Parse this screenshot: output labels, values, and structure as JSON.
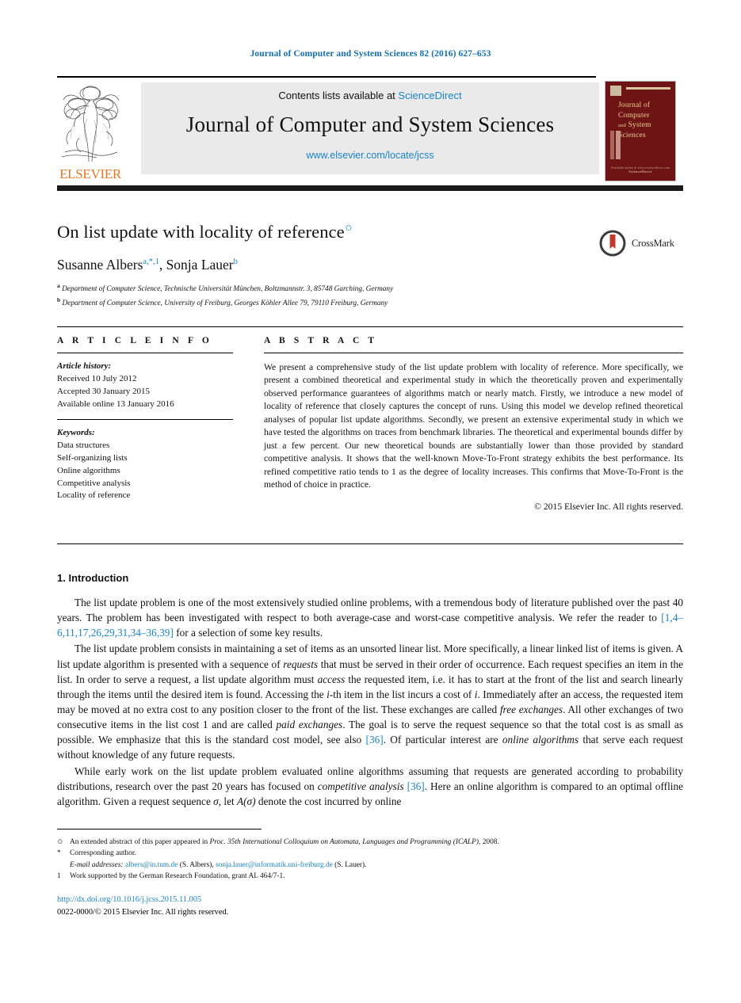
{
  "running_head": "Journal of Computer and System Sciences 82 (2016) 627–653",
  "masthead": {
    "contents_prefix": "Contents lists available at ",
    "sciencedirect": "ScienceDirect",
    "journal_name": "Journal of Computer and System Sciences",
    "journal_url": "www.elsevier.com/locate/jcss",
    "publisher_wordmark": "ELSEVIER",
    "cover": {
      "line1": "Journal of",
      "line2": "Computer",
      "line3_small": "and",
      "line3": "System",
      "line4": "Sciences",
      "foot1": "Available online at www.sciencedirect.com",
      "foot2": "ScienceDirect"
    }
  },
  "article": {
    "title": "On list update with locality of reference",
    "title_footnote_mark": "✩",
    "authors": "Susanne Albers, Sonja Lauer",
    "author1": "Susanne Albers",
    "author1_marks": "a,*,1",
    "author2": "Sonja Lauer",
    "author2_marks": "b",
    "affiliations": [
      {
        "mark": "a",
        "text": "Department of Computer Science, Technische Universität München, Boltzmannstr. 3, 85748 Garching, Germany"
      },
      {
        "mark": "b",
        "text": "Department of Computer Science, University of Freiburg, Georges Köhler Allee 79, 79110 Freiburg, Germany"
      }
    ],
    "crossmark_label": "CrossMark"
  },
  "info": {
    "heading": "A R T I C L E    I N F O",
    "history_label": "Article history:",
    "history": [
      "Received 10 July 2012",
      "Accepted 30 January 2015",
      "Available online 13 January 2016"
    ],
    "keywords_label": "Keywords:",
    "keywords": [
      "Data structures",
      "Self-organizing lists",
      "Online algorithms",
      "Competitive analysis",
      "Locality of reference"
    ]
  },
  "abstract": {
    "heading": "A B S T R A C T",
    "text": "We present a comprehensive study of the list update problem with locality of reference. More specifically, we present a combined theoretical and experimental study in which the theoretically proven and experimentally observed performance guarantees of algorithms match or nearly match. Firstly, we introduce a new model of locality of reference that closely captures the concept of runs. Using this model we develop refined theoretical analyses of popular list update algorithms. Secondly, we present an extensive experimental study in which we have tested the algorithms on traces from benchmark libraries. The theoretical and experimental bounds differ by just a few percent. Our new theoretical bounds are substantially lower than those provided by standard competitive analysis. It shows that the well-known Move-To-Front strategy exhibits the best performance. Its refined competitive ratio tends to 1 as the degree of locality increases. This confirms that Move-To-Front is the method of choice in practice.",
    "copyright": "© 2015 Elsevier Inc. All rights reserved."
  },
  "body": {
    "section_number_title": "1. Introduction",
    "paragraph1_part1": "The list update problem is one of the most extensively studied online problems, with a tremendous body of literature published over the past 40 years. The problem has been investigated with respect to both average-case and worst-case competitive analysis. We refer the reader to ",
    "paragraph1_citation": "[1,4–6,11,17,26,29,31,34–36,39]",
    "paragraph1_part2": " for a selection of some key results.",
    "paragraph2_part1": "The list update problem consists in maintaining a set of items as an unsorted linear list. More specifically, a linear linked list of items is given. A list update algorithm is presented with a sequence of ",
    "paragraph2_it1": "requests",
    "paragraph2_part2": " that must be served in their order of occurrence. Each request specifies an item in the list. In order to serve a request, a list update algorithm must ",
    "paragraph2_it2": "access",
    "paragraph2_part3": " the requested item, i.e. it has to start at the front of the list and search linearly through the items until the desired item is found. Accessing the ",
    "paragraph2_it3": "i",
    "paragraph2_part4": "-th item in the list incurs a cost of ",
    "paragraph2_it4": "i",
    "paragraph2_part5": ". Immediately after an access, the requested item may be moved at no extra cost to any position closer to the front of the list. These exchanges are called ",
    "paragraph2_it5": "free exchanges",
    "paragraph2_part6": ". All other exchanges of two consecutive items in the list cost 1 and are called ",
    "paragraph2_it6": "paid exchanges",
    "paragraph2_part7": ". The goal is to serve the request sequence so that the total cost is as small as possible. We emphasize that this is the standard cost model, see also ",
    "paragraph2_citation": "[36]",
    "paragraph2_part8": ". Of particular interest are ",
    "paragraph2_it7": "online algorithms",
    "paragraph2_part9": " that serve each request without knowledge of any future requests.",
    "paragraph3_part1": "While early work on the list update problem evaluated online algorithms assuming that requests are generated according to probability distributions, research over the past 20 years has focused on ",
    "paragraph3_it1": "competitive analysis",
    "paragraph3_part2": " ",
    "paragraph3_citation": "[36]",
    "paragraph3_part3": ". Here an online algorithm is compared to an optimal offline algorithm. Given a request sequence ",
    "paragraph3_it2": "σ",
    "paragraph3_part4": ", let ",
    "paragraph3_it3": "A(σ)",
    "paragraph3_part5": " denote the cost incurred by online"
  },
  "footnotes": {
    "fn_star_mark": "✩",
    "fn_star_part1": "An extended abstract of this paper appeared in ",
    "fn_star_italic": "Proc. 35th International Colloquium on Automata, Languages and Programming (ICALP)",
    "fn_star_part2": ", 2008.",
    "fn_asterisk_mark": "*",
    "fn_asterisk_text": "Corresponding author.",
    "fn_email_label": "E-mail addresses:",
    "fn_email1": "albers@in.tum.de",
    "fn_email1_owner": " (S. Albers), ",
    "fn_email2": "sonja.lauer@informatik.uni-freiburg.de",
    "fn_email2_owner": " (S. Lauer).",
    "fn_one_mark": "1",
    "fn_one_text": "Work supported by the German Research Foundation, grant AL 464/7-1."
  },
  "footer": {
    "doi": "http://dx.doi.org/10.1016/j.jcss.2015.11.005",
    "issn_copyright": "0022-0000/© 2015 Elsevier Inc. All rights reserved."
  },
  "colors": {
    "link_blue": "#1b84c6",
    "header_blue": "#1270b0",
    "elsevier_orange": "#e87722",
    "cover_maroon": "#6e1414",
    "box_gray": "#eaeaea"
  }
}
